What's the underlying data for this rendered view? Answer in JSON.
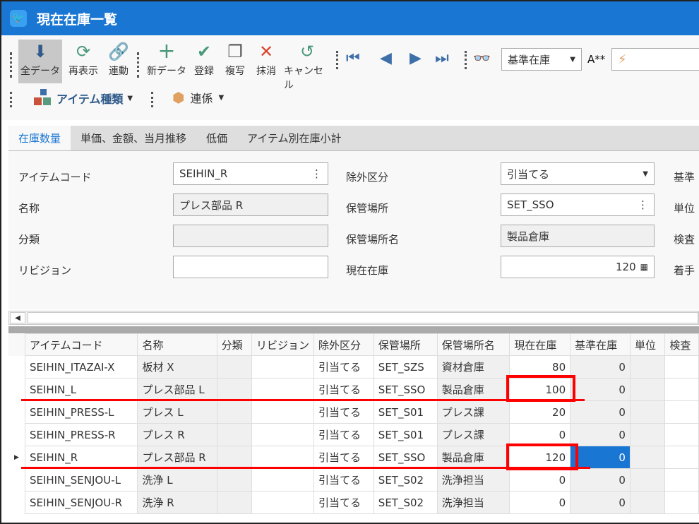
{
  "window": {
    "title": "現在在庫一覧"
  },
  "toolbar": {
    "buttons": [
      {
        "label": "全データ",
        "icon": "download-circle-icon"
      },
      {
        "label": "再表示",
        "icon": "refresh-icon"
      },
      {
        "label": "連動",
        "icon": "link-icon"
      },
      {
        "label": "新データ",
        "icon": "plus-icon"
      },
      {
        "label": "登録",
        "icon": "check-circle-icon"
      },
      {
        "label": "複写",
        "icon": "copy-icon"
      },
      {
        "label": "抹消",
        "icon": "x-icon"
      },
      {
        "label": "キャンセル",
        "icon": "undo-icon"
      }
    ],
    "sort_combo": "基準在庫",
    "search_mode": "A**",
    "search_value": "",
    "item_type": "アイテム種類",
    "relation": "連係"
  },
  "tabs": [
    "在庫数量",
    "単価、金額、当月推移",
    "低価",
    "アイテム別在庫小計"
  ],
  "form": {
    "item_code": {
      "label": "アイテムコード",
      "value": "SEIHIN_R"
    },
    "name": {
      "label": "名称",
      "value": "プレス部品 R"
    },
    "category": {
      "label": "分類",
      "value": ""
    },
    "revision": {
      "label": "リビジョン",
      "value": ""
    },
    "exclusion": {
      "label": "除外区分",
      "value": "引当てる"
    },
    "location": {
      "label": "保管場所",
      "value": "SET_SSO"
    },
    "location_name": {
      "label": "保管場所名",
      "value": "製品倉庫"
    },
    "current_stock": {
      "label": "現在在庫",
      "value": "120"
    },
    "right_labels": [
      "基準",
      "単位",
      "検査",
      "着手"
    ]
  },
  "grid": {
    "columns": [
      "アイテムコード",
      "名称",
      "分類",
      "リビジョン",
      "除外区分",
      "保管場所",
      "保管場所名",
      "現在在庫",
      "基準在庫",
      "単位",
      "検査"
    ],
    "rows": [
      [
        "SEIHIN_ITAZAI-X",
        "板材 X",
        "",
        "",
        "引当てる",
        "SET_SZS",
        "資材倉庫",
        "80",
        "0",
        "",
        ""
      ],
      [
        "SEIHIN_L",
        "プレス部品 L",
        "",
        "",
        "引当てる",
        "SET_SSO",
        "製品倉庫",
        "100",
        "0",
        "",
        ""
      ],
      [
        "SEIHIN_PRESS-L",
        "プレス L",
        "",
        "",
        "引当てる",
        "SET_S01",
        "プレス課",
        "20",
        "0",
        "",
        ""
      ],
      [
        "SEIHIN_PRESS-R",
        "プレス R",
        "",
        "",
        "引当てる",
        "SET_S01",
        "プレス課",
        "0",
        "0",
        "",
        ""
      ],
      [
        "SEIHIN_R",
        "プレス部品 R",
        "",
        "",
        "引当てる",
        "SET_SSO",
        "製品倉庫",
        "120",
        "0",
        "",
        ""
      ],
      [
        "SEIHIN_SENJOU-L",
        "洗浄 L",
        "",
        "",
        "引当てる",
        "SET_S02",
        "洗浄担当",
        "0",
        "0",
        "",
        ""
      ],
      [
        "SEIHIN_SENJOU-R",
        "洗浄 R",
        "",
        "",
        "引当てる",
        "SET_S02",
        "洗浄担当",
        "0",
        "0",
        "",
        ""
      ]
    ],
    "current_row": 4,
    "selected_color": "#1976d2"
  },
  "colors": {
    "titlebar": "#1976d2",
    "annotation": "#ff0000"
  }
}
